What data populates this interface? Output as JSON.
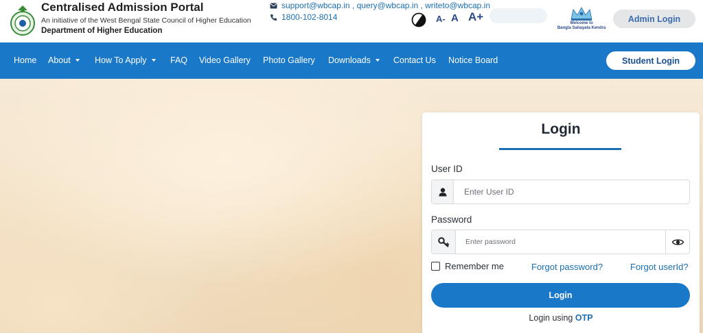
{
  "header": {
    "title": "Centralised Admission Portal",
    "subtitle": "An initiative of the West Bengal State Council of Higher Education",
    "department": "Department of Higher Education",
    "emails": "support@wbcap.in , query@wbcap.in , writeto@wbcap.in",
    "phone": "1800-102-8014",
    "font_decrease": "A-",
    "font_normal": "A",
    "font_increase": "A+",
    "bsk_caption_1": "Welcome to",
    "bsk_caption_2": "Bangla Sahayata Kendra",
    "admin_login_label": "Admin Login"
  },
  "nav": {
    "items": [
      {
        "label": "Home"
      },
      {
        "label": "About"
      },
      {
        "label": "How To Apply"
      },
      {
        "label": "FAQ"
      },
      {
        "label": "Video Gallery"
      },
      {
        "label": "Photo Gallery"
      },
      {
        "label": "Downloads"
      },
      {
        "label": "Contact Us"
      },
      {
        "label": "Notice Board"
      }
    ],
    "student_login_label": "Student Login"
  },
  "login": {
    "title": "Login",
    "userid_label": "User ID",
    "userid_placeholder": "Enter User ID",
    "password_label": "Password",
    "password_placeholder": "Enter password",
    "remember_label": "Remember me",
    "forgot_password": "Forgot password?",
    "forgot_userid": "Forgot userId?",
    "submit_label": "Login",
    "otp_prefix": "Login using",
    "otp_link": "OTP"
  },
  "colors": {
    "primary_blue": "#1a78c9",
    "link_blue": "#1a6fb3",
    "admin_button_bg": "#e5e6e8"
  },
  "icons": {
    "email": "envelope-icon",
    "phone": "phone-icon",
    "contrast": "contrast-icon",
    "user": "user-icon",
    "key": "key-icon",
    "eye": "eye-icon"
  }
}
